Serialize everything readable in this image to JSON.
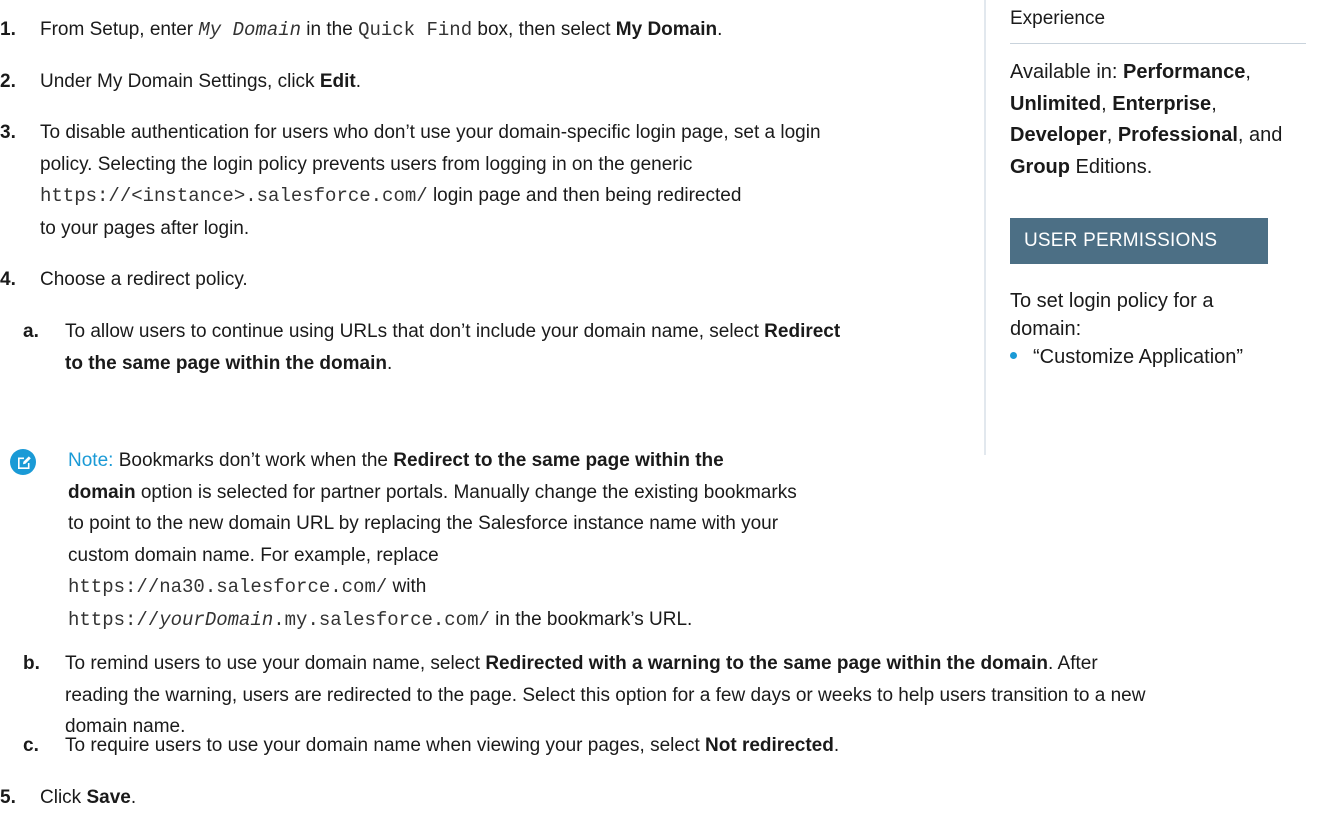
{
  "steps": {
    "s1": {
      "num": "1.",
      "t1": "From Setup, enter ",
      "code1": "My Domain",
      "t2": " in the ",
      "code2": "Quick Find",
      "t3": " box, then select ",
      "b1": "My Domain",
      "t4": "."
    },
    "s2": {
      "num": "2.",
      "t1": "Under My Domain Settings, click ",
      "b1": "Edit",
      "t2": "."
    },
    "s3": {
      "num": "3.",
      "l1": "To disable authentication for users who don’t use your domain-specific login page, set a login",
      "l2": "policy. Selecting the login policy prevents users from logging in on the generic",
      "code": "https://<instance>.salesforce.com/",
      "l3": " login page and then being redirected",
      "l4": "to your pages after login."
    },
    "s4": {
      "num": "4.",
      "text": "Choose a redirect policy."
    },
    "s5": {
      "num": "5.",
      "t1": "Click ",
      "b1": "Save",
      "t2": "."
    }
  },
  "subs": {
    "a": {
      "letter": "a.",
      "t1": "To allow users to continue using URLs that don’t include your domain name, select ",
      "b1": "Redirect",
      "b2": "to the same page within the domain",
      "t2": "."
    },
    "b": {
      "letter": "b.",
      "t1": "To remind users to use your domain name, select ",
      "b1": "Redirected with a warning to the same page within the domain",
      "t2": ". After",
      "l2": "reading the warning, users are redirected to the page. Select this option for a few days or weeks to help users transition to a new",
      "l3": "domain name."
    },
    "c": {
      "letter": "c.",
      "t1": "To require users to use your domain name when viewing your pages, select ",
      "b1": "Not redirected",
      "t2": "."
    }
  },
  "note": {
    "icon": "edit-note-icon",
    "label": "Note:",
    "t1": " Bookmarks don’t work when the ",
    "b1": "Redirect to the same page within the",
    "b2": "domain",
    "t2": " option is selected for partner portals. Manually change the existing bookmarks",
    "l3": "to point to the new domain URL by replacing the Salesforce instance name with your",
    "l4": "custom domain name. For example, replace",
    "code1": "https://na30.salesforce.com/",
    "with": " with",
    "code2a": "https://",
    "code2b": "yourDomain",
    "code2c": ".my.salesforce.com/",
    "t5": " in the bookmark’s URL."
  },
  "sidebar": {
    "edition_heading": "Experience",
    "avail_t1": "Available in: ",
    "e1": "Performance",
    "sep": ",",
    "e2": "Unlimited",
    "e3": "Enterprise",
    "e4": "Developer",
    "e5": "Professional",
    "and": "and ",
    "e6": "Group",
    "editions": " Editions.",
    "perm_heading": "USER PERMISSIONS",
    "perm_req": "To set login policy for a domain:",
    "perm_item": "“Customize Application”",
    "colors": {
      "accent": "#1a9ad6",
      "header_bg": "#4c6f85",
      "border": "#e2e8ee"
    }
  }
}
